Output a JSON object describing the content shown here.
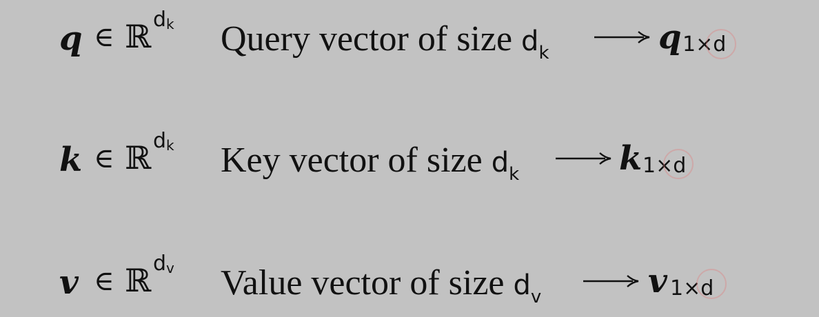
{
  "rows": [
    {
      "id": "q",
      "symbol": "q",
      "in": "∈",
      "reals": "ℝ",
      "dim_base": "d",
      "dim_sub": "k",
      "desc": "Query vector of size ",
      "desc_d": "d",
      "desc_sub": "k",
      "result_symbol": "q",
      "result_sub": "1×d"
    },
    {
      "id": "k",
      "symbol": "k",
      "in": "∈",
      "reals": "ℝ",
      "dim_base": "d",
      "dim_sub": "k",
      "desc": "Key vector of size ",
      "desc_d": "d",
      "desc_sub": "k",
      "result_symbol": "k",
      "result_sub": "1×d"
    },
    {
      "id": "v",
      "symbol": "v",
      "in": "∈",
      "reals": "ℝ",
      "dim_base": "d",
      "dim_sub": "v",
      "desc": "Value vector of size ",
      "desc_d": "d",
      "desc_sub": "v",
      "result_symbol": "v",
      "result_sub": "1×d"
    }
  ],
  "colors": {
    "background": "#c2c2c2",
    "text": "#111111",
    "marker": "#e17878"
  },
  "icons": {
    "arrow": "long-right-arrow-icon",
    "marker": "cursor-highlight-circle-icon"
  }
}
